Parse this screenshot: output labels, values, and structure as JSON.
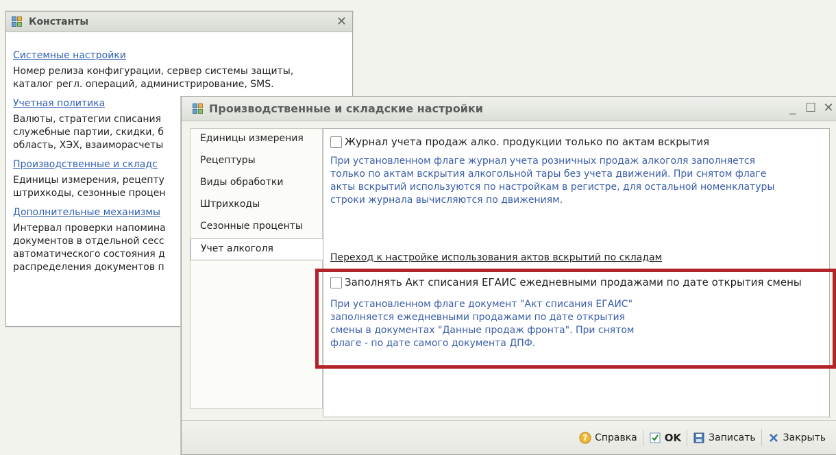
{
  "back_window": {
    "title": "Константы",
    "sections": [
      {
        "link": "Системные настройки",
        "desc": "Номер релиза конфигурации, сервер системы защиты,\nкаталог регл. операций, администрирование, SMS."
      },
      {
        "link": "Учетная политика",
        "desc": "Валюты, стратегии списания\nслужебные партии, скидки, б\nобласть, ХЭХ, взаиморасчеты"
      },
      {
        "link": "Производственные и складс",
        "desc": "Единицы измерения, рецепту\nштрихкоды, сезонные процен"
      },
      {
        "link": "Дополнительные механизмы",
        "desc": "Интервал проверки напомина\nдокументов в отдельной сесс\nавтоматического состояния д\nраспределения документов п"
      }
    ]
  },
  "front_window": {
    "title": "Производственные и складские настройки",
    "tabs": [
      "Единицы измерения",
      "Рецептуры",
      "Виды обработки",
      "Штрихкоды",
      "Сезонные проценты",
      "Учет алкоголя"
    ],
    "active_tab": "Учет алкоголя",
    "content": {
      "checkbox1_label": "Журнал учета продаж алко. продукции только по актам вскрытия",
      "checkbox1_checked": false,
      "info1": "При установленном флаге журнал учета розничных продаж алкоголя заполняется\nтолько по актам вскрытия алкогольной тары без учета движений. При снятом флаге\nакты вскрытий используются по настройкам в регистре, для остальной номенклатуры\nстроки журнала вычисляются по движениям.",
      "nav_link": "Переход к настройке использования актов вскрытий по складам",
      "checkbox2_label": "Заполнять Акт списания ЕГАИС ежедневными продажами  по дате открытия смены",
      "checkbox2_checked": false,
      "info2": "При установленном флаге документ \"Акт списания ЕГАИС\"\nзаполняется ежедневными продажами по дате открытия\nсмены в документах \"Данные продаж фронта\". При снятом\nфлаге - по дате самого документа ДПФ."
    },
    "footer": {
      "help_label": "Справка",
      "ok_label": "OK",
      "save_label": "Записать",
      "close_label": "Закрыть"
    }
  },
  "colors": {
    "link_blue": "#2f5fb5",
    "info_blue": "#3a5ea8",
    "highlight_red": "#b2242a",
    "window_bg": "#f3f3ee"
  },
  "icons": [
    "app-icon",
    "close-icon",
    "minimize-icon",
    "maximize-icon",
    "help-icon",
    "ok-check-icon",
    "save-disk-icon",
    "close-x-icon"
  ]
}
